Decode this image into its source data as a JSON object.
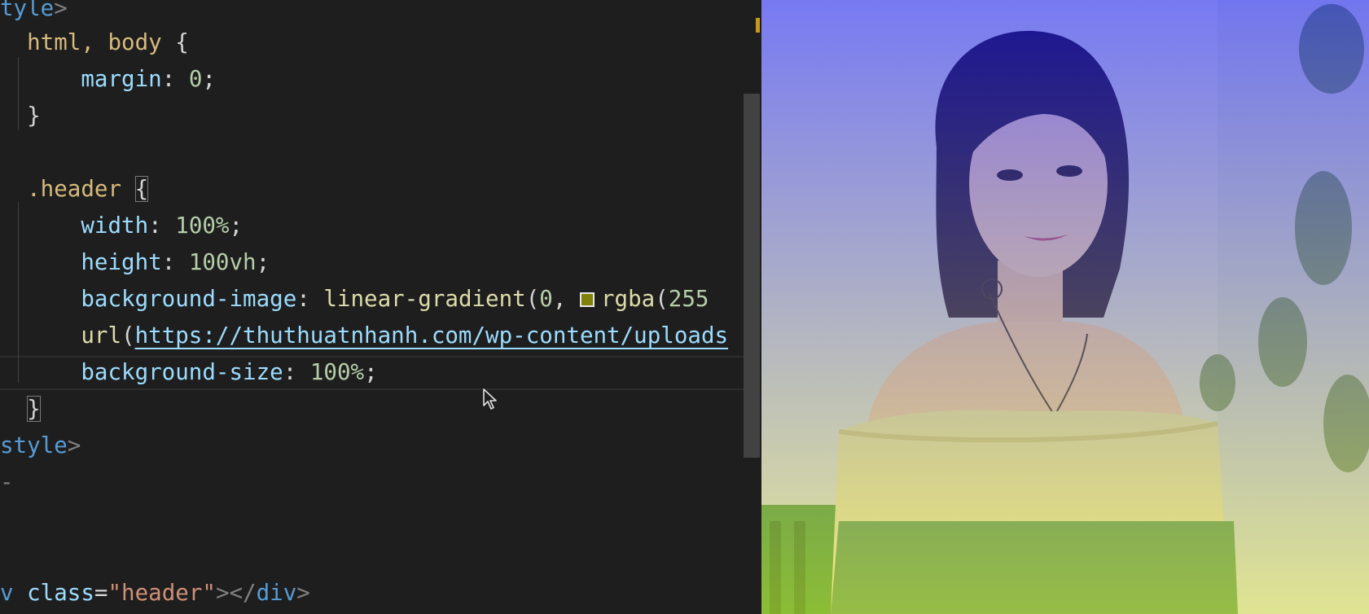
{
  "editor": {
    "lines": [
      [
        {
          "t": "tyle",
          "c": "tag"
        },
        {
          "t": ">",
          "c": "ang"
        }
      ],
      [
        {
          "t": "  "
        },
        {
          "t": "html, body",
          "c": "sel"
        },
        {
          "t": " {",
          "c": "punct"
        }
      ],
      [
        {
          "t": "      "
        },
        {
          "t": "margin",
          "c": "prop"
        },
        {
          "t": ": ",
          "c": "punct"
        },
        {
          "t": "0",
          "c": "num"
        },
        {
          "t": ";",
          "c": "punct"
        }
      ],
      [
        {
          "t": "  "
        },
        {
          "t": "}",
          "c": "punct"
        }
      ],
      [],
      [
        {
          "t": "  "
        },
        {
          "t": ".header",
          "c": "sel"
        },
        {
          "t": " "
        },
        {
          "t": "{",
          "c": "punct brace-box"
        }
      ],
      [
        {
          "t": "      "
        },
        {
          "t": "width",
          "c": "prop"
        },
        {
          "t": ": ",
          "c": "punct"
        },
        {
          "t": "100%",
          "c": "num"
        },
        {
          "t": ";",
          "c": "punct"
        }
      ],
      [
        {
          "t": "      "
        },
        {
          "t": "height",
          "c": "prop"
        },
        {
          "t": ": ",
          "c": "punct"
        },
        {
          "t": "100vh",
          "c": "num"
        },
        {
          "t": ";",
          "c": "punct"
        }
      ],
      [
        {
          "t": "      "
        },
        {
          "t": "background-image",
          "c": "prop"
        },
        {
          "t": ": ",
          "c": "punct"
        },
        {
          "t": "linear-gradient",
          "c": "fn"
        },
        {
          "t": "(",
          "c": "punct"
        },
        {
          "t": "0",
          "c": "num"
        },
        {
          "t": ", ",
          "c": "punct"
        },
        {
          "swatch": true
        },
        {
          "t": "rgba",
          "c": "fn"
        },
        {
          "t": "(",
          "c": "punct"
        },
        {
          "t": "255",
          "c": "num"
        }
      ],
      [
        {
          "t": "      "
        },
        {
          "t": "url",
          "c": "fn"
        },
        {
          "t": "(",
          "c": "punct"
        },
        {
          "t": "https://thuthuatnhanh.com/wp-content/uploads",
          "c": "link"
        }
      ],
      [
        {
          "t": "      "
        },
        {
          "t": "background-size",
          "c": "prop"
        },
        {
          "t": ": ",
          "c": "punct"
        },
        {
          "t": "100%",
          "c": "num"
        },
        {
          "t": ";",
          "c": "punct"
        }
      ],
      [
        {
          "t": "  "
        },
        {
          "t": "}",
          "c": "punct brace-box"
        }
      ],
      [
        {
          "t": "style",
          "c": "tag"
        },
        {
          "t": ">",
          "c": "ang"
        }
      ],
      [
        {
          "t": "-",
          "c": "ang"
        }
      ],
      [],
      [],
      [
        {
          "t": "v",
          "c": "tag"
        },
        {
          "t": " "
        },
        {
          "t": "class",
          "c": "attr"
        },
        {
          "t": "=",
          "c": "punct"
        },
        {
          "t": "\"header\"",
          "c": "str"
        },
        {
          "t": "></",
          "c": "ang"
        },
        {
          "t": "div",
          "c": "tag"
        },
        {
          "t": ">",
          "c": "ang"
        }
      ]
    ]
  },
  "colors": {
    "swatch": "#80800a",
    "gradient_bottom": "rgba(255,255,0,0.35)",
    "gradient_top": "rgba(0,0,255,0.45)"
  },
  "preview": {
    "subject": "portrait-photo"
  }
}
